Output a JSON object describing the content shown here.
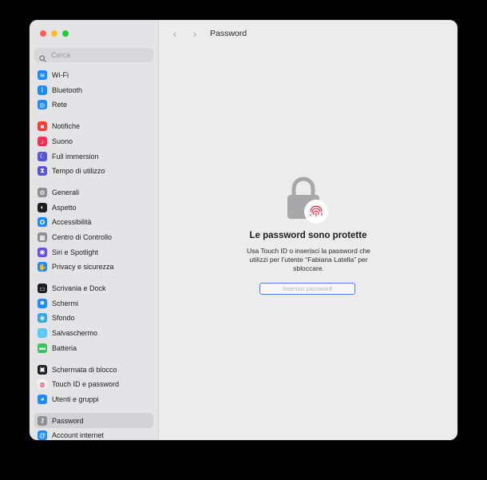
{
  "search": {
    "placeholder": "Cerca"
  },
  "toolbar": {
    "title": "Password",
    "back_label": "‹",
    "forward_label": "›"
  },
  "sidebar": {
    "groups": [
      [
        {
          "label": "Wi-Fi",
          "color": "#1a8cff",
          "glyph": "≋",
          "name": "wifi"
        },
        {
          "label": "Bluetooth",
          "color": "#1a8cff",
          "glyph": "ᛒ",
          "name": "bluetooth"
        },
        {
          "label": "Rete",
          "color": "#1a8cff",
          "glyph": "◎",
          "name": "network"
        }
      ],
      [
        {
          "label": "Notifiche",
          "color": "#ff3b30",
          "glyph": "■",
          "name": "notifications"
        },
        {
          "label": "Suono",
          "color": "#ff2d55",
          "glyph": "♪",
          "name": "sound"
        },
        {
          "label": "Full immersion",
          "color": "#5856d6",
          "glyph": "☾",
          "name": "focus"
        },
        {
          "label": "Tempo di utilizzo",
          "color": "#5856d6",
          "glyph": "⧗",
          "name": "screen-time"
        }
      ],
      [
        {
          "label": "Generali",
          "color": "#8e8e93",
          "glyph": "⚙",
          "name": "general"
        },
        {
          "label": "Aspetto",
          "color": "#1d1d1f",
          "glyph": "◐",
          "name": "appearance"
        },
        {
          "label": "Accessibilità",
          "color": "#1a8cff",
          "glyph": "✪",
          "name": "accessibility"
        },
        {
          "label": "Centro di Controllo",
          "color": "#8e8e93",
          "glyph": "▦",
          "name": "control-center"
        },
        {
          "label": "Siri e Spotlight",
          "color": "#6b4de6",
          "glyph": "◉",
          "name": "siri"
        },
        {
          "label": "Privacy e sicurezza",
          "color": "#1a8cff",
          "glyph": "✋",
          "name": "privacy"
        }
      ],
      [
        {
          "label": "Scrivania e Dock",
          "color": "#1d1d1f",
          "glyph": "▭",
          "name": "desktop-dock"
        },
        {
          "label": "Schermi",
          "color": "#1a8cff",
          "glyph": "✹",
          "name": "displays"
        },
        {
          "label": "Sfondo",
          "color": "#34aadc",
          "glyph": "❀",
          "name": "wallpaper"
        },
        {
          "label": "Salvaschermo",
          "color": "#5ac8fa",
          "glyph": "◌",
          "name": "screensaver"
        },
        {
          "label": "Batteria",
          "color": "#34c759",
          "glyph": "▬",
          "name": "battery"
        }
      ],
      [
        {
          "label": "Schermata di blocco",
          "color": "#1d1d1f",
          "glyph": "▣",
          "name": "lock-screen"
        },
        {
          "label": "Touch ID e password",
          "color": "#f2f2f2",
          "glyph": "◍",
          "name": "touch-id"
        },
        {
          "label": "Utenti e gruppi",
          "color": "#1a8cff",
          "glyph": "◕",
          "name": "users"
        }
      ],
      [
        {
          "label": "Password",
          "color": "#8e8e93",
          "glyph": "⚷",
          "name": "passwords",
          "selected": true
        },
        {
          "label": "Account internet",
          "color": "#1a8cff",
          "glyph": "@",
          "name": "internet-accounts"
        }
      ]
    ]
  },
  "main": {
    "heading": "Le password sono protette",
    "body": "Usa Touch ID o inserisci la password che utilizzi per l’utente “Fabiana Latella” per sbloccare.",
    "password_placeholder": "Inserisci password"
  },
  "colors": {
    "accent": "#4c7ff0",
    "close": "#ff5f57",
    "minimize": "#febc2e",
    "zoom": "#28c840",
    "fingerprint": "#e0263a"
  }
}
